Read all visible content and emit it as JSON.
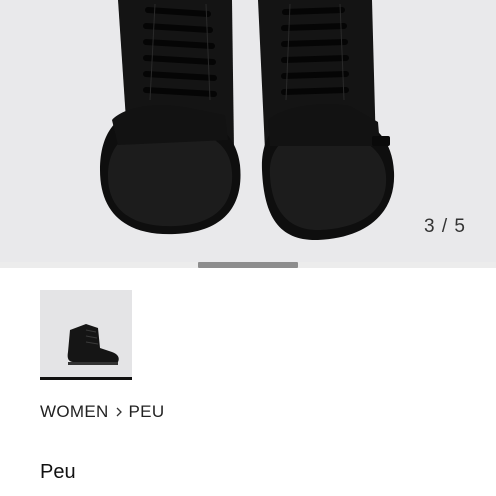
{
  "gallery": {
    "counter": "3 / 5",
    "current_index": 3,
    "total": 5,
    "image_alt": "Black leather ankle boots with laces",
    "colors": {
      "background": "#e9e9eb",
      "shoe": "#111111",
      "scroll_thumb": "#8d8d8d"
    }
  },
  "thumbnails": [
    {
      "name": "thumbnail-1",
      "selected": true
    }
  ],
  "breadcrumb": {
    "items": [
      "WOMEN",
      "PEU"
    ]
  },
  "product": {
    "title": "Peu"
  }
}
